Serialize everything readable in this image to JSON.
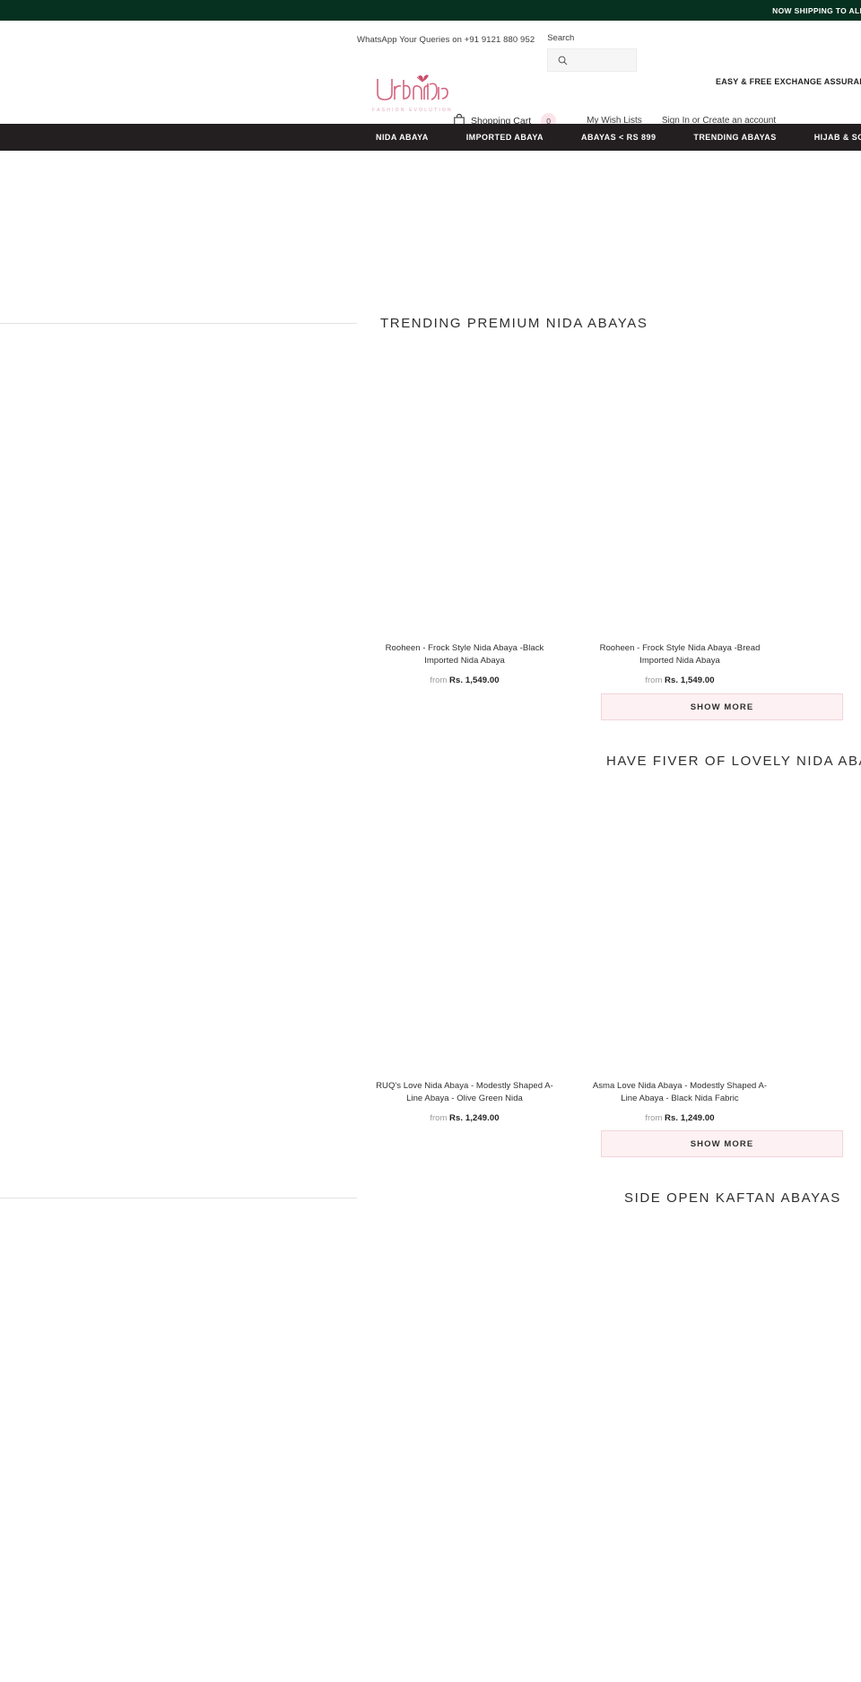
{
  "announcement": {
    "text": "NOW SHIPPING TO ALL OVER INDIA. COD AVAILABLE"
  },
  "header": {
    "whatsapp": "WhatsApp Your Queries on +91 9121 880 952",
    "search_label": "Search",
    "search_value": "",
    "search_placeholder": "",
    "search_icon": "search-icon",
    "logo_text": "UrbanNisa",
    "logo_tagline": "FASHION  EVOLUTION",
    "logo_color": "#d4637f",
    "assurance": "EASY & FREE EXCHANGE ASSURANCE",
    "cart_icon": "shopping-bag-icon",
    "cart_label": "Shopping Cart",
    "cart_count": "0",
    "wishlist_label": "My Wish Lists",
    "auth_label": "Sign In or Create an account"
  },
  "nav": {
    "items": [
      {
        "label": "NIDA ABAYA"
      },
      {
        "label": "IMPORTED ABAYA"
      },
      {
        "label": "ABAYAS < RS 899"
      },
      {
        "label": "TRENDING ABAYAS"
      },
      {
        "label": "HIJAB & SCARVES"
      }
    ]
  },
  "sections": [
    {
      "title": "TRENDING PREMIUM NIDA ABAYAS",
      "show_more": "SHOW MORE",
      "products": [
        {
          "title": "Rooheen - Frock Style Nida Abaya -Black Imported Nida Abaya",
          "price_prefix": "from",
          "price": "Rs. 1,549.00"
        },
        {
          "title": "Rooheen - Frock Style Nida Abaya -Bread Imported Nida Abaya",
          "price_prefix": "from",
          "price": "Rs. 1,549.00"
        }
      ]
    },
    {
      "title": "HAVE FIVER OF LOVELY NIDA ABAYAS",
      "show_more": "SHOW MORE",
      "products": [
        {
          "title": "RUQ's Love Nida Abaya - Modestly Shaped A-Line Abaya - Olive Green Nida",
          "price_prefix": "from",
          "price": "Rs. 1,249.00"
        },
        {
          "title": "Asma Love Nida Abaya - Modestly Shaped A-Line Abaya - Black Nida Fabric",
          "price_prefix": "from",
          "price": "Rs. 1,249.00"
        }
      ]
    },
    {
      "title": "SIDE OPEN KAFTAN ABAYAS",
      "show_more": "",
      "products": []
    }
  ],
  "colors": {
    "announce_bg": "#06301f",
    "nav_bg": "#231f20",
    "brand_pink": "#d4637f",
    "button_bg": "#fdf1f3",
    "button_border": "#f3d3da"
  }
}
